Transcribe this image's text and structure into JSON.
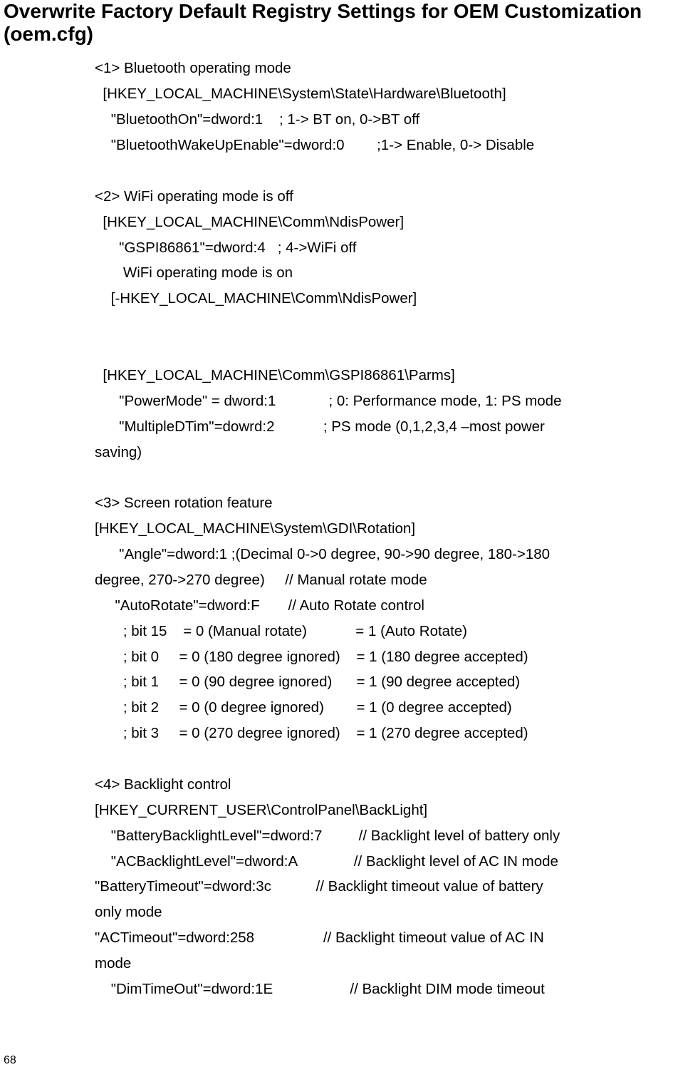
{
  "title": "Overwrite Factory Default Registry Settings for OEM Customization (oem.cfg)",
  "content": {
    "lines": [
      "<1> Bluetooth operating mode",
      "  [HKEY_LOCAL_MACHINE\\System\\State\\Hardware\\Bluetooth]",
      "    \"BluetoothOn\"=dword:1    ; 1-> BT on, 0->BT off",
      "    \"BluetoothWakeUpEnable\"=dword:0        ;1-> Enable, 0-> Disable",
      "",
      "<2> WiFi operating mode is off",
      "  [HKEY_LOCAL_MACHINE\\Comm\\NdisPower]",
      "      \"GSPI86861\"=dword:4   ; 4->WiFi off",
      "       WiFi operating mode is on",
      "    [-HKEY_LOCAL_MACHINE\\Comm\\NdisPower]",
      "",
      "",
      "  [HKEY_LOCAL_MACHINE\\Comm\\GSPI86861\\Parms]",
      "      \"PowerMode\" = dword:1             ; 0: Performance mode, 1: PS mode",
      "      \"MultipleDTim\"=dowrd:2            ; PS mode (0,1,2,3,4 –most power",
      "saving)",
      "",
      "<3> Screen rotation feature",
      "[HKEY_LOCAL_MACHINE\\System\\GDI\\Rotation]",
      "      \"Angle\"=dword:1 ;(Decimal 0->0 degree, 90->90 degree, 180->180",
      "degree, 270->270 degree)     // Manual rotate mode",
      "     \"AutoRotate\"=dword:F       // Auto Rotate control",
      "       ; bit 15    = 0 (Manual rotate)            = 1 (Auto Rotate)",
      "       ; bit 0     = 0 (180 degree ignored)    = 1 (180 degree accepted)",
      "       ; bit 1     = 0 (90 degree ignored)      = 1 (90 degree accepted)",
      "       ; bit 2     = 0 (0 degree ignored)        = 1 (0 degree accepted)",
      "       ; bit 3     = 0 (270 degree ignored)    = 1 (270 degree accepted)",
      "",
      "<4> Backlight control",
      "[HKEY_CURRENT_USER\\ControlPanel\\BackLight]",
      "    \"BatteryBacklightLevel\"=dword:7         // Backlight level of battery only",
      "    \"ACBacklightLevel\"=dword:A              // Backlight level of AC IN mode",
      "\"BatteryTimeout\"=dword:3c           // Backlight timeout value of battery",
      "only mode",
      "\"ACTimeout\"=dword:258                 // Backlight timeout value of AC IN",
      "mode",
      "    \"DimTimeOut\"=dword:1E                   // Backlight DIM mode timeout"
    ]
  },
  "page_number": "68"
}
